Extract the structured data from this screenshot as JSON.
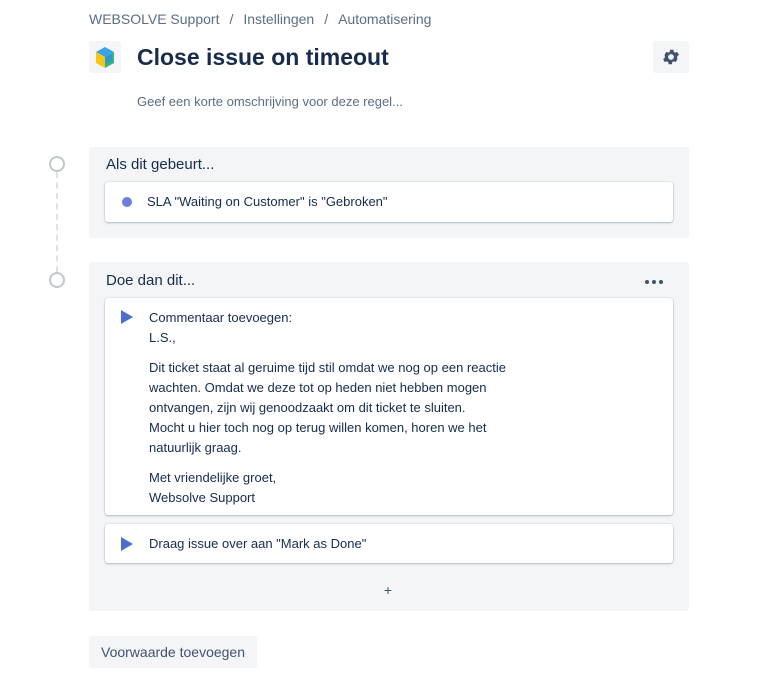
{
  "breadcrumb": {
    "items": [
      "WEBSOLVE Support",
      "Instellingen",
      "Automatisering"
    ],
    "separator": "/"
  },
  "header": {
    "title": "Close issue on timeout",
    "description_placeholder": "Geef een korte omschrijving voor deze regel..."
  },
  "trigger_block": {
    "heading": "Als dit gebeurt...",
    "item": "SLA \"Waiting on Customer\" is \"Gebroken\""
  },
  "action_block": {
    "heading": "Doe dan dit...",
    "comment": {
      "label": "Commentaar toevoegen:",
      "greeting": "L.S.,",
      "body_lines": [
        "Dit ticket staat al geruime tijd stil omdat we nog op een reactie",
        "wachten. Omdat we deze tot op heden niet hebben mogen",
        "ontvangen, zijn wij genoodzaakt om dit ticket te sluiten.",
        "Mocht u hier toch nog op terug willen komen, horen we het",
        "natuurlijk graag."
      ],
      "closing_lines": [
        "Met vriendelijke groet,",
        "Websolve Support"
      ]
    },
    "transition": "Draag issue over aan \"Mark as Done\"",
    "add_label": "+"
  },
  "footer": {
    "add_condition_label": "Voorwaarde toevoegen"
  },
  "colors": {
    "accent": "#4c6fce",
    "block_bg": "#f4f5f7",
    "text": "#172b4d"
  }
}
